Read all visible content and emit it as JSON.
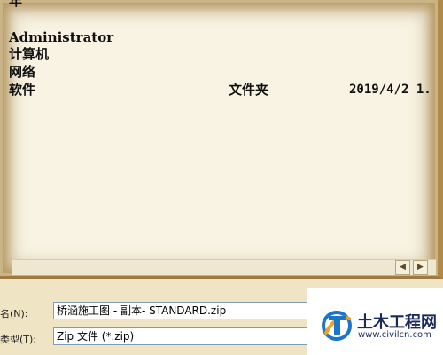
{
  "file_list": {
    "rows": [
      {
        "name": "年",
        "type": "",
        "date": ""
      },
      {
        "name": "Administrator",
        "type": "",
        "date": ""
      },
      {
        "name": "计算机",
        "type": "",
        "date": ""
      },
      {
        "name": "网络",
        "type": "",
        "date": ""
      },
      {
        "name": "软件",
        "type": "文件夹",
        "date": "2019/4/2 1."
      }
    ]
  },
  "scrollbar": {
    "left_arrow": "◀",
    "right_arrow": "▶"
  },
  "file_name": {
    "label": "名(N):",
    "value": "桥涵施工图 - 副本- STANDARD.zip"
  },
  "file_type": {
    "label": "类型(T):",
    "value": "Zip 文件 (*.zip)"
  },
  "watermark": {
    "title": "土木工程网",
    "url": "www.civilcn.com"
  }
}
